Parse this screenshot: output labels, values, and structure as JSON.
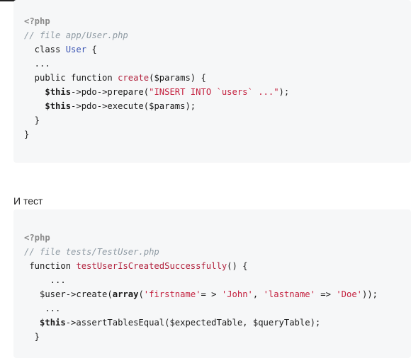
{
  "block1": {
    "lines": [
      {
        "parts": [
          {
            "t": "<?php",
            "c": "tag"
          }
        ]
      },
      {
        "parts": [
          {
            "t": "// file app/User.php",
            "c": "cmt"
          }
        ]
      },
      {
        "parts": [
          {
            "t": "  class ",
            "c": "kw"
          },
          {
            "t": "User",
            "c": "cls"
          },
          {
            "t": " {",
            "c": "kw"
          }
        ]
      },
      {
        "parts": [
          {
            "t": "  ...",
            "c": "kw"
          }
        ]
      },
      {
        "parts": [
          {
            "t": "  public function ",
            "c": "kw"
          },
          {
            "t": "create",
            "c": "fn"
          },
          {
            "t": "($params) {",
            "c": "kw"
          }
        ]
      },
      {
        "parts": [
          {
            "t": "    ",
            "c": "kw"
          },
          {
            "t": "$this",
            "c": "bold"
          },
          {
            "t": "->pdo->prepare(",
            "c": "kw"
          },
          {
            "t": "\"INSERT INTO `users` ...\"",
            "c": "str"
          },
          {
            "t": ");",
            "c": "kw"
          }
        ]
      },
      {
        "parts": [
          {
            "t": "    ",
            "c": "kw"
          },
          {
            "t": "$this",
            "c": "bold"
          },
          {
            "t": "->pdo->execute($params);",
            "c": "kw"
          }
        ]
      },
      {
        "parts": [
          {
            "t": "  }",
            "c": "kw"
          }
        ]
      },
      {
        "parts": [
          {
            "t": "}",
            "c": "kw"
          }
        ]
      }
    ]
  },
  "prose": {
    "text": "И тест"
  },
  "block2": {
    "lines": [
      {
        "parts": [
          {
            "t": "<?php",
            "c": "tag"
          }
        ]
      },
      {
        "parts": [
          {
            "t": "// file tests/TestUser.php",
            "c": "cmt"
          }
        ]
      },
      {
        "parts": [
          {
            "t": " function ",
            "c": "kw"
          },
          {
            "t": "testUserIsCreatedSuccessfully",
            "c": "fn"
          },
          {
            "t": "() {",
            "c": "kw"
          }
        ]
      },
      {
        "parts": [
          {
            "t": "     ...",
            "c": "kw"
          }
        ]
      },
      {
        "parts": [
          {
            "t": "   $user->create(",
            "c": "kw"
          },
          {
            "t": "array",
            "c": "bold"
          },
          {
            "t": "(",
            "c": "kw"
          },
          {
            "t": "'firstname'",
            "c": "str"
          },
          {
            "t": "= > ",
            "c": "kw"
          },
          {
            "t": "'John'",
            "c": "str"
          },
          {
            "t": ", ",
            "c": "kw"
          },
          {
            "t": "'lastname'",
            "c": "str"
          },
          {
            "t": " => ",
            "c": "kw"
          },
          {
            "t": "'Doe'",
            "c": "str"
          },
          {
            "t": "));",
            "c": "kw"
          }
        ]
      },
      {
        "parts": [
          {
            "t": "    ...",
            "c": "kw"
          }
        ]
      },
      {
        "parts": [
          {
            "t": "   ",
            "c": "kw"
          },
          {
            "t": "$this",
            "c": "bold"
          },
          {
            "t": "->assertTablesEqual($expectedTable, $queryTable);",
            "c": "kw"
          }
        ]
      },
      {
        "parts": [
          {
            "t": "  }",
            "c": "kw"
          }
        ]
      }
    ]
  }
}
